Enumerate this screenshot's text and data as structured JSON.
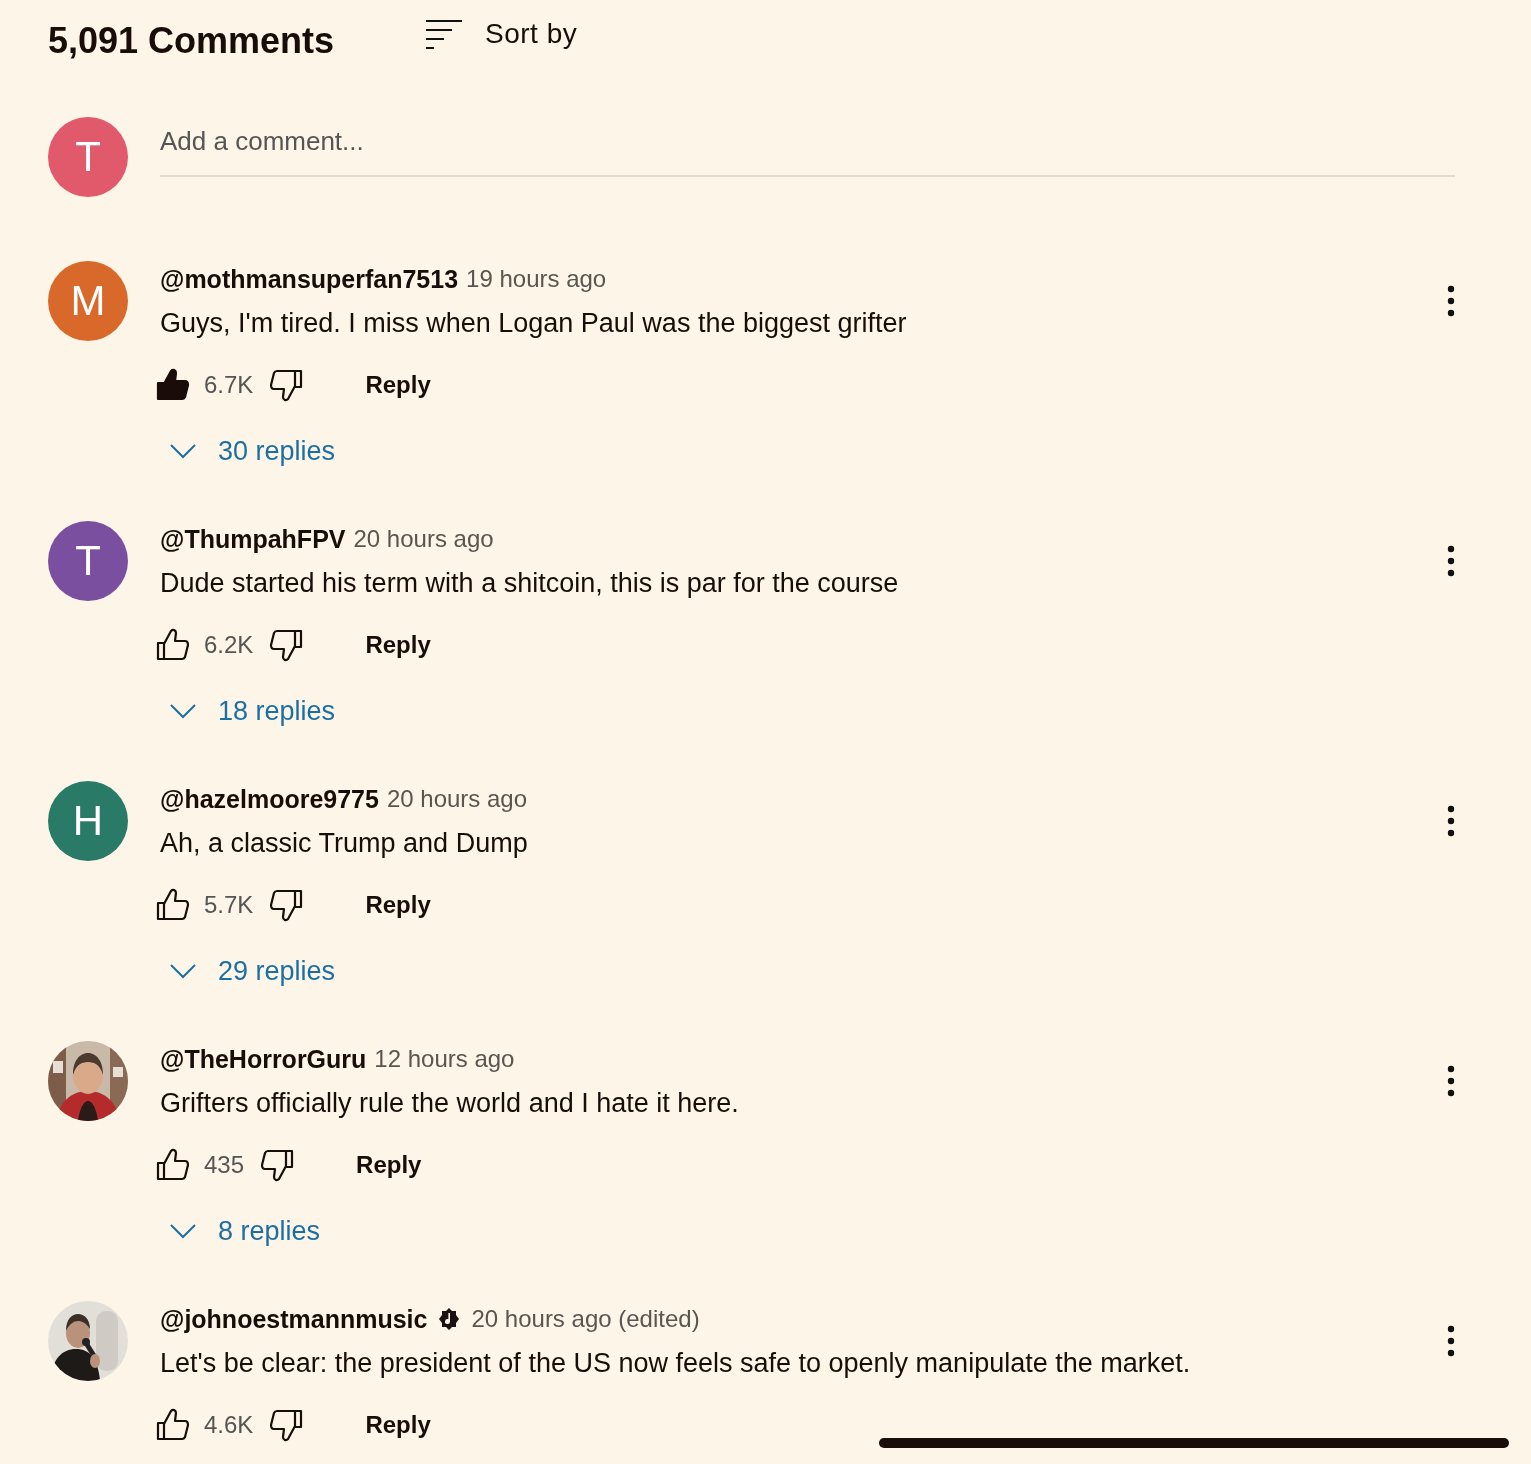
{
  "header": {
    "title": "5,091 Comments",
    "sort_label": "Sort by"
  },
  "composer": {
    "avatar": {
      "letter": "T",
      "color": "#e05a6b"
    },
    "placeholder": "Add a comment..."
  },
  "comments": [
    {
      "author": "@mothmansuperfan7513",
      "verified": false,
      "time": "19 hours ago",
      "text": "Guys, I'm tired. I miss when Logan Paul was the biggest grifter",
      "likes": "6.7K",
      "liked": true,
      "reply_label": "Reply",
      "replies": "30 replies",
      "avatar": {
        "kind": "letter",
        "letter": "M",
        "color": "#d9692a"
      }
    },
    {
      "author": "@ThumpahFPV",
      "verified": false,
      "time": "20 hours ago",
      "text": "Dude started his term with a shitcoin, this is par for the course",
      "likes": "6.2K",
      "liked": false,
      "reply_label": "Reply",
      "replies": "18 replies",
      "avatar": {
        "kind": "letter",
        "letter": "T",
        "color": "#7b4fa0"
      }
    },
    {
      "author": "@hazelmoore9775",
      "verified": false,
      "time": "20 hours ago",
      "text": "Ah, a classic Trump and Dump",
      "likes": "5.7K",
      "liked": false,
      "reply_label": "Reply",
      "replies": "29 replies",
      "avatar": {
        "kind": "letter",
        "letter": "H",
        "color": "#2a7a68"
      }
    },
    {
      "author": "@TheHorrorGuru",
      "verified": false,
      "time": "12 hours ago",
      "text": "Grifters officially rule the world and I hate it here.",
      "likes": "435",
      "liked": false,
      "reply_label": "Reply",
      "replies": "8 replies"
    },
    {
      "author": "@johnoestmannmusic",
      "verified": true,
      "time": "20 hours ago (edited)",
      "text": "Let's be clear: the president of the US now feels safe to openly manipulate the market.",
      "likes": "4.6K",
      "liked": false,
      "reply_label": "Reply"
    }
  ]
}
